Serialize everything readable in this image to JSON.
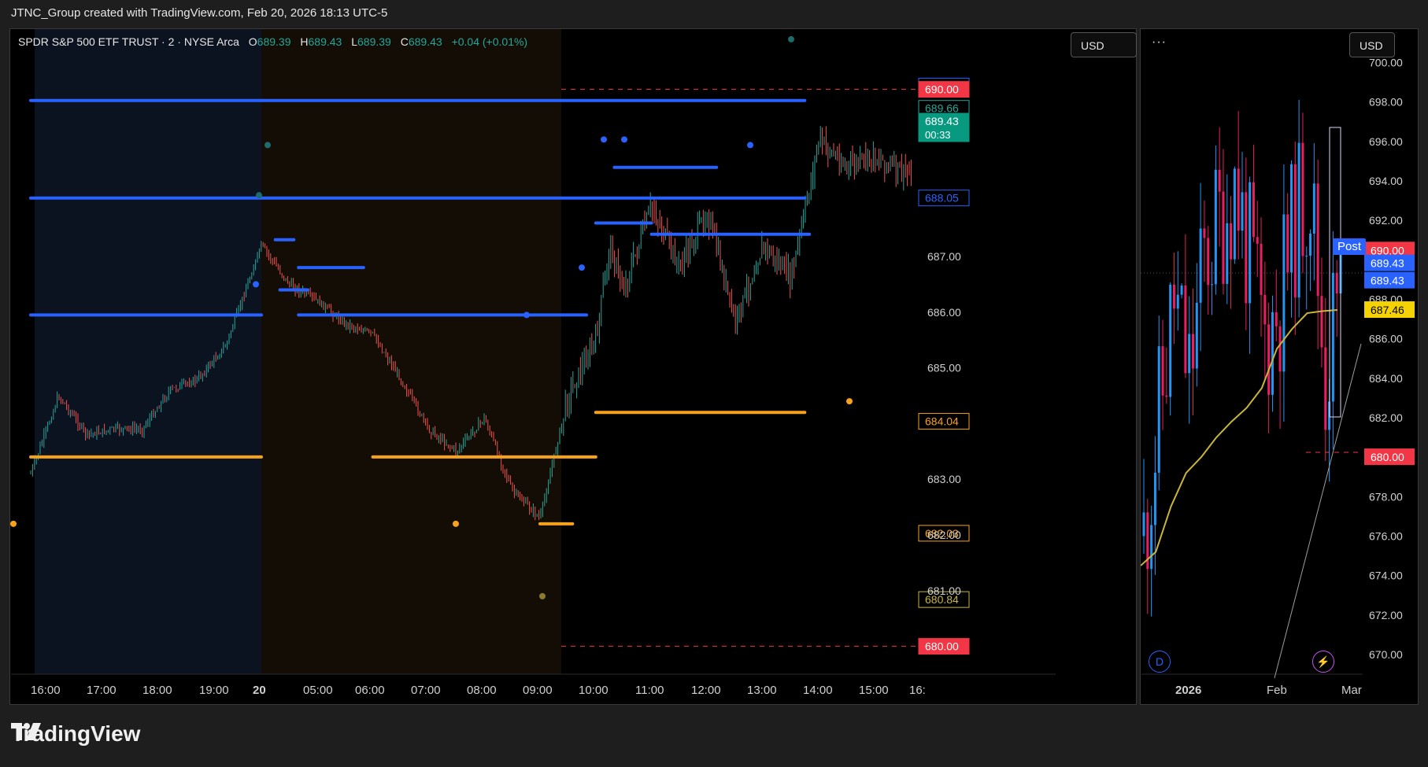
{
  "header": {
    "caption": "JTNC_Group created with TradingView.com, Feb 20, 2026 18:13 UTC-5"
  },
  "left_chart": {
    "legend": {
      "symbol": "SPDR S&P 500 ETF TRUST · 2 · NYSE Arca",
      "o_label": "O",
      "o_value": "689.39",
      "h_label": "H",
      "h_value": "689.43",
      "l_label": "L",
      "l_value": "689.39",
      "c_label": "C",
      "c_value": "689.43",
      "change": "+0.04 (+0.01%)"
    },
    "currency_button": "USD"
  },
  "right_chart": {
    "menu_label": "···",
    "currency_button": "USD",
    "post_label": "Post",
    "badge_d": "D",
    "badge_flash": "⚡"
  },
  "brand": {
    "name": "TradingView"
  },
  "colors": {
    "up": "#26a69a",
    "down": "#ef5350",
    "blue": "#2962ff",
    "orange": "#f7a21b",
    "red_level": "#f23645",
    "ma_line": "#c8b53c",
    "candle_blue": "#2196f3",
    "candle_pink": "#e91e63"
  },
  "chart_data": [
    {
      "type": "line",
      "title": "SPDR S&P 500 ETF TRUST · 2 · NYSE Arca",
      "x_tick_labels": [
        "16:00",
        "17:00",
        "18:00",
        "19:00",
        "20",
        "05:00",
        "06:00",
        "07:00",
        "08:00",
        "09:00",
        "10:00",
        "11:00",
        "12:00",
        "13:00",
        "14:00",
        "15:00",
        "16:"
      ],
      "y_tick_labels": [
        "687.00",
        "686.00",
        "685.00",
        "683.00",
        "682.00",
        "681.00"
      ],
      "ylim": [
        679.5,
        690.8
      ],
      "sessions": [
        "post-market (previous day)",
        "pre-market",
        "regular session"
      ],
      "price_path": {
        "x": [
          "16:00",
          "16:30",
          "17:00",
          "17:30",
          "18:00",
          "18:30",
          "19:00",
          "19:30",
          "20 04:00",
          "04:30",
          "05:00",
          "05:30",
          "06:00",
          "06:30",
          "07:00",
          "07:30",
          "08:00",
          "08:30",
          "09:00",
          "09:30",
          "10:00",
          "10:15",
          "10:30",
          "11:00",
          "11:30",
          "12:00",
          "12:30",
          "13:00",
          "13:30",
          "13:45",
          "14:00",
          "14:30",
          "15:00",
          "15:30",
          "16:00"
        ],
        "y": [
          683.1,
          684.5,
          683.8,
          683.9,
          683.9,
          684.6,
          684.8,
          685.4,
          687.2,
          686.5,
          686.2,
          685.8,
          685.6,
          684.8,
          683.9,
          683.5,
          684.1,
          682.8,
          682.3,
          684.5,
          685.5,
          687.2,
          686.4,
          687.9,
          686.8,
          687.8,
          685.8,
          687.2,
          686.6,
          687.8,
          689.1,
          688.6,
          688.8,
          688.5,
          689.43
        ]
      },
      "horizontal_levels": [
        {
          "value": 690.06,
          "label": "690.06",
          "color": "#2962ff"
        },
        {
          "value": 690.0,
          "label": "690.00",
          "color": "#f23645"
        },
        {
          "value": 689.66,
          "label": "689.66",
          "color": "#26a69a"
        },
        {
          "value": 689.43,
          "label": "689.43",
          "countdown": "00:33",
          "color": "#089981"
        },
        {
          "value": 688.05,
          "label": "688.05",
          "color": "#2962ff"
        },
        {
          "value": 684.04,
          "label": "684.04",
          "color": "#f7a21b"
        },
        {
          "value": 682.03,
          "label": "682.03",
          "color": "#f7a21b"
        },
        {
          "value": 680.84,
          "label": "680.84",
          "color": "#c8b53c"
        },
        {
          "value": 680.0,
          "label": "680.00",
          "color": "#f23645"
        }
      ],
      "indicator_segments": [
        {
          "color": "blue",
          "y": 685.95,
          "from": "16:00",
          "to": "20 04:00"
        },
        {
          "color": "orange",
          "y": 683.4,
          "from": "16:00",
          "to": "20 04:00"
        },
        {
          "color": "blue",
          "y": 686.4,
          "from": "04:20",
          "to": "04:50"
        },
        {
          "color": "blue",
          "y": 687.3,
          "from": "04:15",
          "to": "04:35"
        },
        {
          "color": "blue",
          "y": 686.8,
          "from": "04:40",
          "to": "05:50"
        },
        {
          "color": "blue",
          "y": 685.95,
          "from": "04:40",
          "to": "09:50"
        },
        {
          "color": "orange",
          "y": 683.4,
          "from": "06:00",
          "to": "10:00"
        },
        {
          "color": "orange",
          "y": 682.2,
          "from": "09:00",
          "to": "09:35"
        },
        {
          "color": "blue",
          "y": 687.6,
          "from": "10:00",
          "to": "11:00"
        },
        {
          "color": "blue",
          "y": 687.4,
          "from": "11:00",
          "to": "13:50"
        },
        {
          "color": "blue",
          "y": 688.6,
          "from": "10:20",
          "to": "12:10"
        },
        {
          "color": "orange",
          "y": 684.2,
          "from": "10:00",
          "to": "13:45"
        },
        {
          "color": "blue",
          "y": 689.8,
          "from": "13:45",
          "to": "16:00"
        },
        {
          "color": "blue",
          "y": 688.05,
          "from": "13:45",
          "to": "16:00"
        }
      ]
    },
    {
      "type": "line",
      "title": "",
      "x_tick_labels": [
        "2026",
        "Feb",
        "Mar"
      ],
      "y_tick_labels": [
        "700.00",
        "698.00",
        "696.00",
        "694.00",
        "692.00",
        "688.00",
        "686.00",
        "684.00",
        "682.00",
        "678.00",
        "676.00",
        "674.00",
        "672.00",
        "670.00"
      ],
      "ylim": [
        669,
        700.5
      ],
      "price_path": {
        "x": [
          0,
          4,
          8,
          12,
          16,
          20,
          24,
          28,
          32,
          36,
          40,
          44,
          48,
          52
        ],
        "y": [
          676,
          682,
          688,
          684,
          690,
          692,
          694,
          690,
          686,
          688,
          692,
          694,
          684,
          689.43
        ]
      },
      "moving_average": {
        "label": "687.46",
        "x": [
          0,
          4,
          8,
          12,
          16,
          20,
          24,
          28,
          32,
          36,
          40,
          44,
          48,
          52
        ],
        "y": [
          674.5,
          675.2,
          677.5,
          679.2,
          680.0,
          681.0,
          681.8,
          682.5,
          683.5,
          685.5,
          686.5,
          687.3,
          687.4,
          687.46
        ]
      },
      "price_labels": [
        {
          "value": 690.0,
          "label": "690.00",
          "color": "#f23645"
        },
        {
          "value": 689.43,
          "label": "689.43",
          "color": "#2962ff"
        },
        {
          "value": 689.43,
          "label": "689.43",
          "color": "#2962ff"
        },
        {
          "value": 687.46,
          "label": "687.46",
          "color": "#f5d300"
        },
        {
          "value": 680.0,
          "label": "680.00",
          "color": "#f23645"
        }
      ]
    }
  ]
}
